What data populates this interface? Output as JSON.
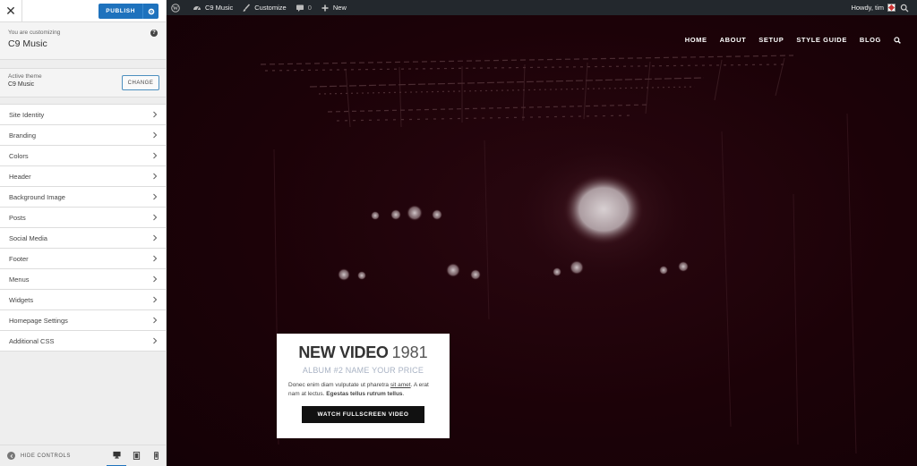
{
  "sidebar": {
    "publish_label": "PUBLISH",
    "customizing_label": "You are customizing",
    "site_title": "C9 Music",
    "active_theme_label": "Active theme",
    "active_theme_name": "C9 Music",
    "change_label": "CHANGE",
    "sections": [
      {
        "label": "Site Identity"
      },
      {
        "label": "Branding"
      },
      {
        "label": "Colors"
      },
      {
        "label": "Header"
      },
      {
        "label": "Background Image"
      },
      {
        "label": "Posts"
      },
      {
        "label": "Social Media"
      },
      {
        "label": "Footer"
      },
      {
        "label": "Menus"
      },
      {
        "label": "Widgets"
      },
      {
        "label": "Homepage Settings"
      },
      {
        "label": "Additional CSS"
      }
    ],
    "hide_controls_label": "HIDE CONTROLS",
    "active_device": "desktop"
  },
  "adminbar": {
    "site_name": "C9 Music",
    "customize_label": "Customize",
    "comments_count": "0",
    "new_label": "New",
    "greeting": "Howdy, tim"
  },
  "site": {
    "nav": [
      "HOME",
      "ABOUT",
      "SETUP",
      "STYLE GUIDE",
      "BLOG"
    ],
    "card": {
      "title": "NEW VIDEO",
      "year": "1981",
      "subtitle": "ALBUM #2 NAME YOUR PRICE",
      "text_before": "Donec enim diam vulputate ut pharetra ",
      "text_link": "sit amet",
      "text_after": ". A erat nam at lectus. ",
      "text_bold": "Egestas tellus rutrum tellus",
      "text_end": ".",
      "button_label": "WATCH FULLSCREEN VIDEO"
    }
  },
  "colors": {
    "accent": "#1e72bd",
    "adminbar": "#23282d",
    "preview_bg": "#1c0208"
  }
}
